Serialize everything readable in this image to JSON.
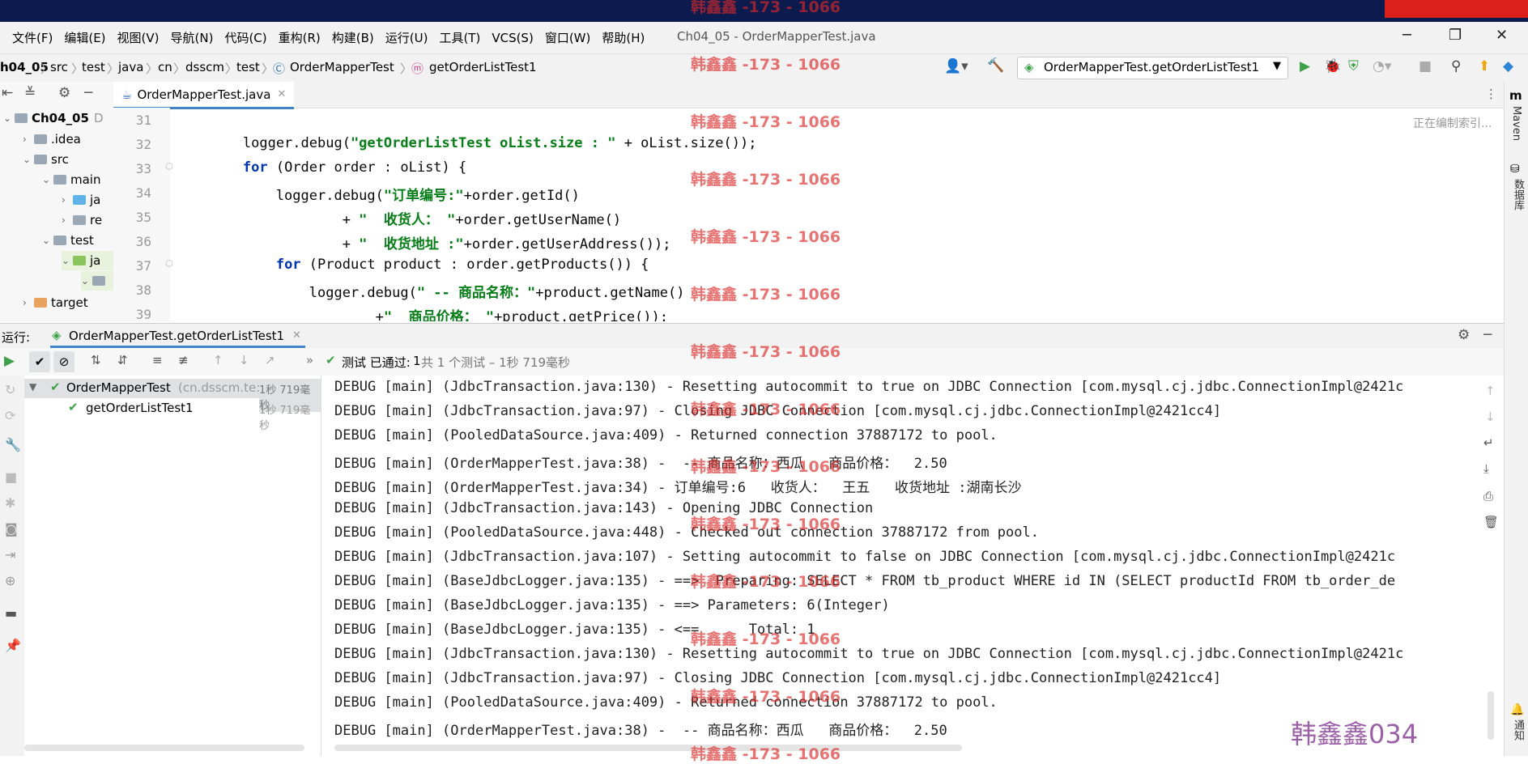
{
  "menu": {
    "items": [
      "文件(F)",
      "编辑(E)",
      "视图(V)",
      "导航(N)",
      "代码(C)",
      "重构(R)",
      "构建(B)",
      "运行(U)",
      "工具(T)",
      "VCS(S)",
      "窗口(W)",
      "帮助(H)"
    ],
    "window_title": "Ch04_05 - OrderMapperTest.java"
  },
  "breadcrumb": [
    "h04_05",
    "src",
    "test",
    "java",
    "cn",
    "dsscm",
    "test",
    "OrderMapperTest",
    "getOrderListTest1"
  ],
  "run_config": "OrderMapperTest.getOrderListTest1",
  "project_tree": [
    {
      "label": "Ch04_05",
      "extra": "D",
      "indent": 0,
      "type": "folder"
    },
    {
      "label": ".idea",
      "indent": 1,
      "type": "folder"
    },
    {
      "label": "src",
      "indent": 1,
      "type": "folder"
    },
    {
      "label": "main",
      "indent": 2,
      "type": "folder"
    },
    {
      "label": "ja",
      "indent": 3,
      "type": "blue"
    },
    {
      "label": "re",
      "indent": 3,
      "type": "folder"
    },
    {
      "label": "test",
      "indent": 2,
      "type": "folder"
    },
    {
      "label": "ja",
      "indent": 3,
      "type": "green"
    },
    {
      "label": "",
      "indent": 4,
      "type": "folder"
    },
    {
      "label": "target",
      "indent": 1,
      "type": "orange"
    }
  ],
  "editor": {
    "tab_label": "OrderMapperTest.java",
    "status_hint": "正在编制索引...",
    "lines": [
      {
        "n": "31",
        "segments": []
      },
      {
        "n": "32",
        "segments": [
          {
            "t": "        logger.debug(",
            "c": ""
          },
          {
            "t": "\"getOrderListTest oList.size : \"",
            "c": "str"
          },
          {
            "t": " + oList.size());",
            "c": ""
          }
        ]
      },
      {
        "n": "33",
        "segments": [
          {
            "t": "        ",
            "c": ""
          },
          {
            "t": "for",
            "c": "kw"
          },
          {
            "t": " (Order order : oList) {",
            "c": ""
          }
        ]
      },
      {
        "n": "34",
        "segments": [
          {
            "t": "            logger.debug(",
            "c": ""
          },
          {
            "t": "\"订单编号:\"",
            "c": "str"
          },
          {
            "t": "+order.getId()",
            "c": ""
          }
        ]
      },
      {
        "n": "35",
        "segments": [
          {
            "t": "                    + ",
            "c": ""
          },
          {
            "t": "\"  收货人： \"",
            "c": "str"
          },
          {
            "t": "+order.getUserName()",
            "c": ""
          }
        ]
      },
      {
        "n": "36",
        "segments": [
          {
            "t": "                    + ",
            "c": ""
          },
          {
            "t": "\"  收货地址 :\"",
            "c": "str"
          },
          {
            "t": "+order.getUserAddress());",
            "c": ""
          }
        ]
      },
      {
        "n": "37",
        "segments": [
          {
            "t": "            ",
            "c": ""
          },
          {
            "t": "for",
            "c": "kw"
          },
          {
            "t": " (Product product : order.getProducts()) {",
            "c": ""
          }
        ]
      },
      {
        "n": "38",
        "segments": [
          {
            "t": "                logger.debug(",
            "c": ""
          },
          {
            "t": "\" -- 商品名称：\"",
            "c": "str"
          },
          {
            "t": "+product.getName()",
            "c": ""
          }
        ]
      },
      {
        "n": "39",
        "segments": [
          {
            "t": "                        +",
            "c": ""
          },
          {
            "t": "\"  商品价格： \"",
            "c": "str"
          },
          {
            "t": "+product.getPrice());",
            "c": ""
          }
        ]
      }
    ]
  },
  "run": {
    "label": "运行:",
    "tab_label": "OrderMapperTest.getOrderListTest1",
    "status_prefix": "测试 已通过: ",
    "status_count": "1",
    "status_detail": "共 1 个测试 – 1秒 719毫秒",
    "tree": [
      {
        "label": "OrderMapperTest",
        "sub": "(cn.dsscm.te:",
        "time": "1秒 719毫秒"
      },
      {
        "label": "getOrderListTest1",
        "sub": "",
        "time": "1秒 719毫秒"
      }
    ],
    "log": [
      "DEBUG [main] (JdbcTransaction.java:130) - Resetting autocommit to true on JDBC Connection [com.mysql.cj.jdbc.ConnectionImpl@2421c",
      "DEBUG [main] (JdbcTransaction.java:97) - Closing JDBC Connection [com.mysql.cj.jdbc.ConnectionImpl@2421cc4]",
      "DEBUG [main] (PooledDataSource.java:409) - Returned connection 37887172 to pool.",
      "DEBUG [main] (OrderMapperTest.java:38) -  -- 商品名称：西瓜   商品价格：  2.50",
      "DEBUG [main] (OrderMapperTest.java:34) - 订单编号:6   收货人：  王五   收货地址 :湖南长沙",
      "DEBUG [main] (JdbcTransaction.java:143) - Opening JDBC Connection",
      "DEBUG [main] (PooledDataSource.java:448) - Checked out connection 37887172 from pool.",
      "DEBUG [main] (JdbcTransaction.java:107) - Setting autocommit to false on JDBC Connection [com.mysql.cj.jdbc.ConnectionImpl@2421c",
      "DEBUG [main] (BaseJdbcLogger.java:135) - ==>  Preparing: SELECT * FROM tb_product WHERE id IN (SELECT productId FROM tb_order_de",
      "DEBUG [main] (BaseJdbcLogger.java:135) - ==> Parameters: 6(Integer)",
      "DEBUG [main] (BaseJdbcLogger.java:135) - <==      Total: 1",
      "DEBUG [main] (JdbcTransaction.java:130) - Resetting autocommit to true on JDBC Connection [com.mysql.cj.jdbc.ConnectionImpl@2421c",
      "DEBUG [main] (JdbcTransaction.java:97) - Closing JDBC Connection [com.mysql.cj.jdbc.ConnectionImpl@2421cc4]",
      "DEBUG [main] (PooledDataSource.java:409) - Returned connection 37887172 to pool.",
      "DEBUG [main] (OrderMapperTest.java:38) -  -- 商品名称：西瓜   商品价格：  2.50"
    ]
  },
  "side_labels": {
    "maven": "Maven",
    "database": "数据库",
    "notifications": "通知"
  },
  "watermark": "韩鑫鑫 -173 - 1066",
  "signature": "韩鑫鑫034",
  "colors": {
    "accent": "#4083c9",
    "pass": "#3fa14a",
    "keyword": "#0033b3",
    "string": "#067d17"
  }
}
